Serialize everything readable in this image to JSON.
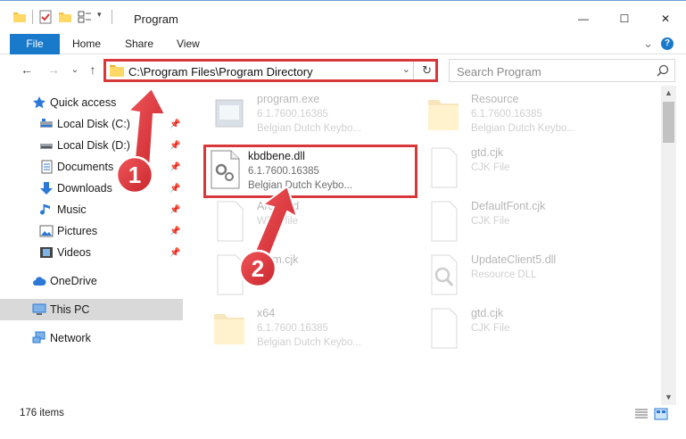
{
  "window": {
    "title": "Program",
    "minimize": "—",
    "maximize": "☐",
    "close": "✕"
  },
  "ribbon": {
    "tabs": [
      "File",
      "Home",
      "Share",
      "View"
    ],
    "expand": "⌄",
    "help": "?"
  },
  "nav": {
    "back": "←",
    "forward": "→",
    "recent": "⌄",
    "up": "↑",
    "address": "C:\\Program Files\\Program Directory",
    "address_dropdown": "⌄",
    "refresh": "↻",
    "search_placeholder": "Search Program"
  },
  "sidebar": {
    "items": [
      {
        "label": "Quick access",
        "icon": "star-icon",
        "pinned": false
      },
      {
        "label": "Local Disk (C:)",
        "icon": "drive-icon",
        "pinned": true
      },
      {
        "label": "Local Disk (D:)",
        "icon": "drive-icon",
        "pinned": true
      },
      {
        "label": "Documents",
        "icon": "documents-icon",
        "pinned": true
      },
      {
        "label": "Downloads",
        "icon": "downloads-icon",
        "pinned": true
      },
      {
        "label": "Music",
        "icon": "music-icon",
        "pinned": true
      },
      {
        "label": "Pictures",
        "icon": "pictures-icon",
        "pinned": true
      },
      {
        "label": "Videos",
        "icon": "videos-icon",
        "pinned": true
      },
      {
        "label": "OneDrive",
        "icon": "cloud-icon",
        "pinned": false
      },
      {
        "label": "This PC",
        "icon": "computer-icon",
        "pinned": false
      },
      {
        "label": "Network",
        "icon": "network-icon",
        "pinned": false
      }
    ]
  },
  "files": [
    {
      "name": "program.exe",
      "line2": "6.1.7600.16385",
      "line3": "Belgian Dutch Keybo...",
      "icon": "exe-icon"
    },
    {
      "name": "Resource",
      "line2": "6.1.7600.16385",
      "line3": "Belgian Dutch Keybo...",
      "icon": "folder-icon"
    },
    {
      "name": "kbdbene.dll",
      "line2": "6.1.7600.16385",
      "line3": "Belgian Dutch Keybo...",
      "icon": "dll-icon"
    },
    {
      "name": "gtd.cjk",
      "line2": "CJK File",
      "line3": "",
      "icon": "file-icon"
    },
    {
      "name": "Arc...ard",
      "line2": "WBM file",
      "line3": "",
      "icon": "file-icon"
    },
    {
      "name": "DefaultFont.cjk",
      "line2": "CJK File",
      "line3": "",
      "icon": "file-icon"
    },
    {
      "name": "...om.cjk",
      "line2": "...le",
      "line3": "",
      "icon": "file-icon"
    },
    {
      "name": "UpdateClient5.dll",
      "line2": "Resource DLL",
      "line3": "",
      "icon": "dll-icon"
    },
    {
      "name": "x64",
      "line2": "6.1.7600.16385",
      "line3": "Belgian Dutch Keybo...",
      "icon": "folder-icon"
    },
    {
      "name": "gtd.cjk",
      "line2": "CJK File",
      "line3": "",
      "icon": "file-icon"
    }
  ],
  "status": {
    "items_count": "176 items"
  },
  "annotations": {
    "step1": "1",
    "step2": "2"
  },
  "colors": {
    "accent": "#1979ca",
    "highlight_red": "#d9383a",
    "selected_bg": "#d9d9d9"
  }
}
